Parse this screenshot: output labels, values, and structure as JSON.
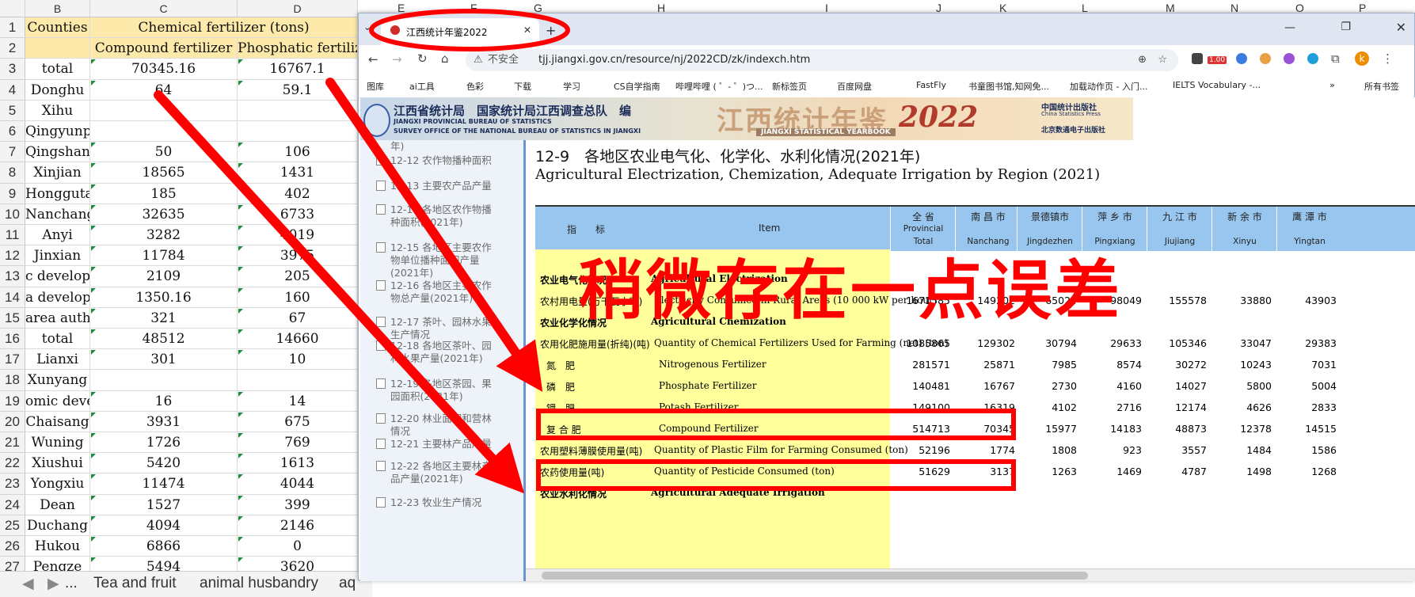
{
  "excel": {
    "columns": [
      "B",
      "C",
      "D"
    ],
    "header_row1": {
      "b": "Counties",
      "cd": "Chemical fertilizer (tons)"
    },
    "header_row2": {
      "c": "Compound fertilizer",
      "d": "Phosphatic fertilizer"
    },
    "rows": [
      {
        "n": "3",
        "b": "total",
        "c": "70345.16",
        "d": "16767.1"
      },
      {
        "n": "4",
        "b": "Donghu",
        "c": "64",
        "d": "59.1"
      },
      {
        "n": "5",
        "b": "Xihu",
        "c": "",
        "d": ""
      },
      {
        "n": "6",
        "b": "Qingyunpu",
        "c": "",
        "d": ""
      },
      {
        "n": "7",
        "b": "Qingshanhu",
        "c": "50",
        "d": "106"
      },
      {
        "n": "8",
        "b": "Xinjian",
        "c": "18565",
        "d": "1431"
      },
      {
        "n": "9",
        "b": "Honggutang",
        "c": "185",
        "d": "402"
      },
      {
        "n": "10",
        "b": "Nanchang",
        "c": "32635",
        "d": "6733"
      },
      {
        "n": "11",
        "b": "Anyi",
        "c": "3282",
        "d": "4019"
      },
      {
        "n": "12",
        "b": "Jinxian",
        "c": "11784",
        "d": "3975"
      },
      {
        "n": "13",
        "b": "c developn",
        "c": "2109",
        "d": "205"
      },
      {
        "n": "14",
        "b": "a developn",
        "c": "1350.16",
        "d": "160"
      },
      {
        "n": "15",
        "b": "area autho",
        "c": "321",
        "d": "67"
      },
      {
        "n": "16",
        "b": "total",
        "c": "48512",
        "d": "14660"
      },
      {
        "n": "17",
        "b": "Lianxi",
        "c": "301",
        "d": "10"
      },
      {
        "n": "18",
        "b": "Xunyang",
        "c": "",
        "d": ""
      },
      {
        "n": "19",
        "b": "omic deve",
        "c": "16",
        "d": "14"
      },
      {
        "n": "20",
        "b": "Chaisang",
        "c": "3931",
        "d": "675"
      },
      {
        "n": "21",
        "b": "Wuning",
        "c": "1726",
        "d": "769"
      },
      {
        "n": "22",
        "b": "Xiushui",
        "c": "5420",
        "d": "1613"
      },
      {
        "n": "23",
        "b": "Yongxiu",
        "c": "11474",
        "d": "4044"
      },
      {
        "n": "24",
        "b": "Dean",
        "c": "1527",
        "d": "399"
      },
      {
        "n": "25",
        "b": "Duchang",
        "c": "4094",
        "d": "2146"
      },
      {
        "n": "26",
        "b": "Hukou",
        "c": "6866",
        "d": "0"
      },
      {
        "n": "27",
        "b": "Pengze",
        "c": "5494",
        "d": "3620"
      }
    ],
    "sheet_tabs": {
      "nav": "...",
      "tab1": "Tea and fruit",
      "tab2": "animal husbandry",
      "tab3": "aq"
    }
  },
  "browser": {
    "tab_title": "江西统计年鉴2022",
    "tab_close": "✕",
    "security_label": "不安全",
    "url": "tjj.jiangxi.gov.cn/resource/nj/2022CD/zk/indexch.htm",
    "top_col_letters": [
      "E",
      "F",
      "G",
      "H",
      "I",
      "J",
      "K",
      "L",
      "M",
      "N",
      "O",
      "P"
    ],
    "badge": "1.00",
    "profile_initial": "k",
    "bookmarks": [
      "图库",
      "ai工具",
      "色彩",
      "下载",
      "学习",
      "CS自学指南",
      "哔哩哔哩 ( ゜- ゜)つ...",
      "新标签页",
      "百度网盘",
      "FastFly",
      "书童图书馆,知网免...",
      "加载动作页 - 入门...",
      "IELTS Vocabulary -..."
    ],
    "bookmarks_more": "»",
    "bookmarks_all": "所有书签"
  },
  "banner": {
    "org_cn": "江西省统计局　国家统计局江西调查总队　编",
    "org_en1": "JIANGXI PROVINCIAL BUREAU OF STATISTICS",
    "org_en2": "SURVEY OFFICE OF THE NATIONAL BUREAU OF STATISTICS IN JIANGXI",
    "title_cn": "江西统计年鉴",
    "year": "2022",
    "title_en": "JIANGXI STATISTICAL YEARBOOK",
    "publisher1": "中国统计出版社",
    "publisher1_en": "China Statistics Press",
    "publisher2": "北京数通电子出版社"
  },
  "sidebar": [
    {
      "text": "年)"
    },
    {
      "text": "12-12 农作物播种面积"
    },
    {
      "text": "12-13 主要农产品产量"
    },
    {
      "text": "12-14 各地区农作物播种面积(2021年)"
    },
    {
      "text": "12-15 各地区主要农作物单位播种面积产量(2021年)"
    },
    {
      "text": "12-16 各地区主要农作物总产量(2021年)"
    },
    {
      "text": "12-17 茶叶、园林水果生产情况"
    },
    {
      "text": "12-18 各地区茶叶、园林水果产量(2021年)"
    },
    {
      "text": "12-19 各地区茶园、果园面积(2021年)"
    },
    {
      "text": "12-20 林业面积和营林情况"
    },
    {
      "text": "12-21 主要林产品产量"
    },
    {
      "text": "12-22 各地区主要林产品产量(2021年)"
    },
    {
      "text": "12-23 牧业生产情况"
    }
  ],
  "table": {
    "title_cn": "12-9　各地区农业电气化、化学化、水利化情况(2021年)",
    "title_en": "Agricultural Electrization, Chemization, Adequate Irrigation by Region (2021)",
    "head_indicator": "指　　标",
    "head_item": "Item",
    "columns": [
      {
        "cn": "全 省",
        "en1": "Provincial",
        "en2": "Total"
      },
      {
        "cn": "南 昌 市",
        "en1": "",
        "en2": "Nanchang"
      },
      {
        "cn": "景德镇市",
        "en1": "",
        "en2": "Jingdezhen"
      },
      {
        "cn": "萍 乡 市",
        "en1": "",
        "en2": "Pingxiang"
      },
      {
        "cn": "九 江 市",
        "en1": "",
        "en2": "Jiujiang"
      },
      {
        "cn": "新 余 市",
        "en1": "",
        "en2": "Xinyu"
      },
      {
        "cn": "鹰 潭 市",
        "en1": "",
        "en2": "Yingtan"
      }
    ],
    "rows": [
      {
        "cn": "农业电气化情况",
        "en": "Agricultural Electrization",
        "bold": true,
        "vals": []
      },
      {
        "cn": "农村用电量(万千瓦小时)",
        "en": "Electricity Consumed in Rural Areas (10 000 kW per hour)",
        "vals": [
          "1671585",
          "149202",
          "65024",
          "98049",
          "155578",
          "33880",
          "43903"
        ]
      },
      {
        "cn": "农业化学化情况",
        "en": "Agricultural Chemization",
        "bold": true,
        "vals": []
      },
      {
        "cn": "农用化肥施用量(折纯)(吨)",
        "en": "Quantity of Chemical Fertilizers Used for Farming (net) (ton)",
        "vals": [
          "1085865",
          "129302",
          "30794",
          "29633",
          "105346",
          "33047",
          "29383"
        ]
      },
      {
        "cn": "氮　肥",
        "en": "Nitrogenous Fertilizer",
        "vals": [
          "281571",
          "25871",
          "7985",
          "8574",
          "30272",
          "10243",
          "7031"
        ]
      },
      {
        "cn": "磷　肥",
        "en": "Phosphate Fertilizer",
        "vals": [
          "140481",
          "16767",
          "2730",
          "4160",
          "14027",
          "5800",
          "5004"
        ]
      },
      {
        "cn": "钾　肥",
        "en": "Potash Fertilizer",
        "vals": [
          "149100",
          "16319",
          "4102",
          "2716",
          "12174",
          "4626",
          "2833"
        ]
      },
      {
        "cn": "复 合 肥",
        "en": "Compound Fertilizer",
        "vals": [
          "514713",
          "70345",
          "15977",
          "14183",
          "48873",
          "12378",
          "14515"
        ]
      },
      {
        "cn": "农用塑料薄膜使用量(吨)",
        "en": "Quantity of Plastic Film for Farming Consumed (ton)",
        "vals": [
          "52196",
          "1774",
          "1808",
          "923",
          "3557",
          "1484",
          "1586"
        ]
      },
      {
        "cn": "农药使用量(吨)",
        "en": "Quantity of Pesticide Consumed (ton)",
        "vals": [
          "51629",
          "3137",
          "1263",
          "1469",
          "4787",
          "1498",
          "1268"
        ]
      },
      {
        "cn": "农业水利化情况",
        "en": "Agricultural Adequate Irrigation",
        "bold": true,
        "vals": []
      }
    ]
  },
  "annotation": {
    "overlay_text": "稍微存在一点误差",
    "color": "#ff0000"
  }
}
